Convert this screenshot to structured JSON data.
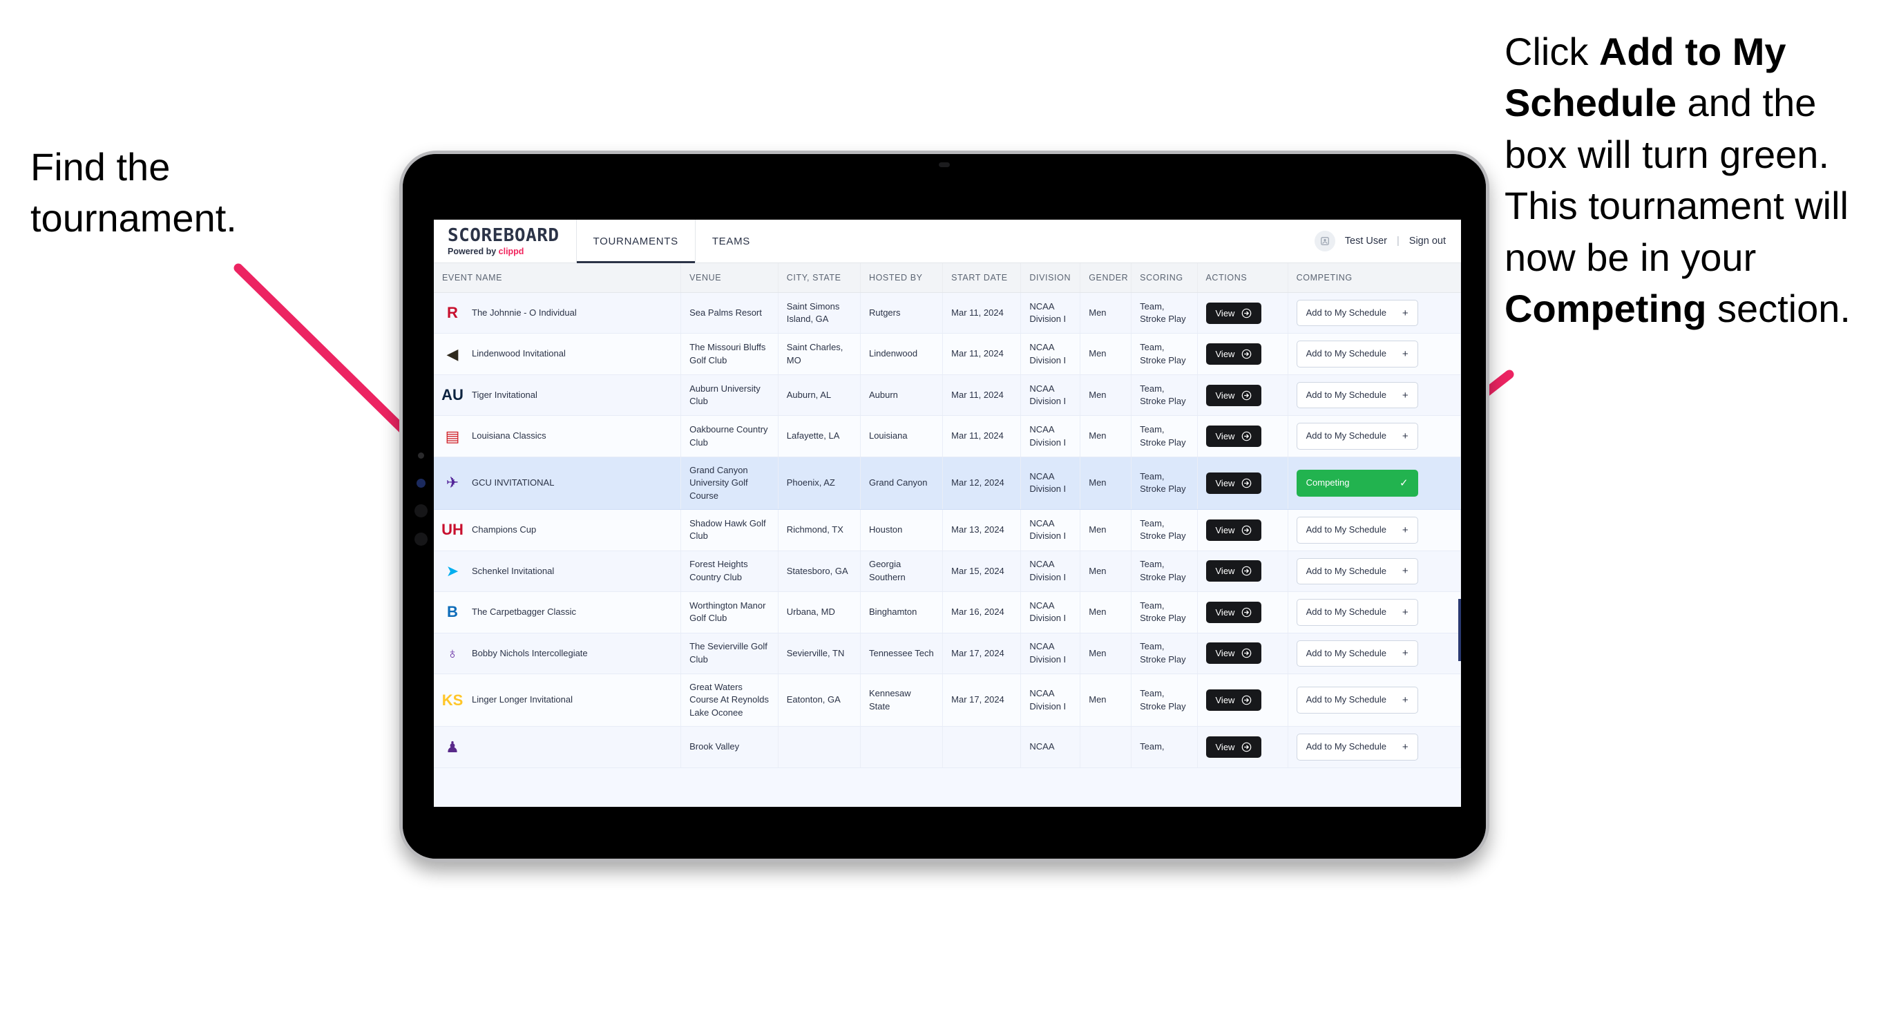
{
  "annotations": {
    "left": {
      "text": "Find the tournament."
    },
    "right": {
      "segments": [
        {
          "t": "Click ",
          "b": false
        },
        {
          "t": "Add to My Schedule",
          "b": true
        },
        {
          "t": " and the box will turn green. This tournament will now be in your ",
          "b": false
        },
        {
          "t": "Competing",
          "b": true
        },
        {
          "t": " section.",
          "b": false
        }
      ]
    },
    "arrow_color": "#ec2462"
  },
  "app": {
    "brand": {
      "name": "SCOREBOARD",
      "powered_prefix": "Powered by ",
      "powered_name": "clippd"
    },
    "tabs": [
      {
        "label": "TOURNAMENTS",
        "active": true
      },
      {
        "label": "TEAMS",
        "active": false
      }
    ],
    "account": {
      "user": "Test User",
      "separator": "|",
      "signout": "Sign out"
    },
    "table": {
      "columns": [
        "EVENT NAME",
        "VENUE",
        "CITY, STATE",
        "HOSTED BY",
        "START DATE",
        "DIVISION",
        "GENDER",
        "SCORING",
        "ACTIONS",
        "COMPETING"
      ],
      "view_label": "View",
      "add_label": "Add to My Schedule",
      "competing_label": "Competing",
      "rows": [
        {
          "logo": "R",
          "logo_color": "#c8102e",
          "logo_font": "serif",
          "event": "The Johnnie - O Individual",
          "venue": "Sea Palms Resort",
          "city": "Saint Simons Island, GA",
          "host": "Rutgers",
          "date": "Mar 11, 2024",
          "division": "NCAA Division I",
          "gender": "Men",
          "scoring": "Team, Stroke Play",
          "competing": false,
          "highlight": false
        },
        {
          "logo": "◀",
          "logo_color": "#2f2a1d",
          "logo_font": "sans",
          "event": "Lindenwood Invitational",
          "venue": "The Missouri Bluffs Golf Club",
          "city": "Saint Charles, MO",
          "host": "Lindenwood",
          "date": "Mar 11, 2024",
          "division": "NCAA Division I",
          "gender": "Men",
          "scoring": "Team, Stroke Play",
          "competing": false,
          "highlight": false
        },
        {
          "logo": "AU",
          "logo_color": "#0c2340",
          "logo_font": "serif",
          "event": "Tiger Invitational",
          "venue": "Auburn University Club",
          "city": "Auburn, AL",
          "host": "Auburn",
          "date": "Mar 11, 2024",
          "division": "NCAA Division I",
          "gender": "Men",
          "scoring": "Team, Stroke Play",
          "competing": false,
          "highlight": false
        },
        {
          "logo": "▤",
          "logo_color": "#ce181e",
          "logo_font": "sans",
          "event": "Louisiana Classics",
          "venue": "Oakbourne Country Club",
          "city": "Lafayette, LA",
          "host": "Louisiana",
          "date": "Mar 11, 2024",
          "division": "NCAA Division I",
          "gender": "Men",
          "scoring": "Team, Stroke Play",
          "competing": false,
          "highlight": false
        },
        {
          "logo": "✈",
          "logo_color": "#522398",
          "logo_font": "sans",
          "event": "GCU INVITATIONAL",
          "venue": "Grand Canyon University Golf Course",
          "city": "Phoenix, AZ",
          "host": "Grand Canyon",
          "date": "Mar 12, 2024",
          "division": "NCAA Division I",
          "gender": "Men",
          "scoring": "Team, Stroke Play",
          "competing": true,
          "highlight": true
        },
        {
          "logo": "UH",
          "logo_color": "#c8102e",
          "logo_font": "serif",
          "event": "Champions Cup",
          "venue": "Shadow Hawk Golf Club",
          "city": "Richmond, TX",
          "host": "Houston",
          "date": "Mar 13, 2024",
          "division": "NCAA Division I",
          "gender": "Men",
          "scoring": "Team, Stroke Play",
          "competing": false,
          "highlight": false
        },
        {
          "logo": "➤",
          "logo_color": "#00aeef",
          "logo_font": "sans",
          "event": "Schenkel Invitational",
          "venue": "Forest Heights Country Club",
          "city": "Statesboro, GA",
          "host": "Georgia Southern",
          "date": "Mar 15, 2024",
          "division": "NCAA Division I",
          "gender": "Men",
          "scoring": "Team, Stroke Play",
          "competing": false,
          "highlight": false
        },
        {
          "logo": "B",
          "logo_color": "#0d6cb9",
          "logo_font": "serif",
          "event": "The Carpetbagger Classic",
          "venue": "Worthington Manor Golf Club",
          "city": "Urbana, MD",
          "host": "Binghamton",
          "date": "Mar 16, 2024",
          "division": "NCAA Division I",
          "gender": "Men",
          "scoring": "Team, Stroke Play",
          "competing": false,
          "highlight": false
        },
        {
          "logo": "♁",
          "logo_color": "#5f259f",
          "logo_font": "sans",
          "event": "Bobby Nichols Intercollegiate",
          "venue": "The Sevierville Golf Club",
          "city": "Sevierville, TN",
          "host": "Tennessee Tech",
          "date": "Mar 17, 2024",
          "division": "NCAA Division I",
          "gender": "Men",
          "scoring": "Team, Stroke Play",
          "competing": false,
          "highlight": false
        },
        {
          "logo": "KS",
          "logo_color": "#ffc629",
          "logo_font": "serif",
          "event": "Linger Longer Invitational",
          "venue": "Great Waters Course At Reynolds Lake Oconee",
          "city": "Eatonton, GA",
          "host": "Kennesaw State",
          "date": "Mar 17, 2024",
          "division": "NCAA Division I",
          "gender": "Men",
          "scoring": "Team, Stroke Play",
          "competing": false,
          "highlight": false
        },
        {
          "logo": "♟",
          "logo_color": "#592a8a",
          "logo_font": "sans",
          "event": "",
          "venue": "Brook Valley",
          "city": "",
          "host": "",
          "date": "",
          "division": "NCAA",
          "gender": "",
          "scoring": "Team,",
          "competing": false,
          "highlight": false,
          "partial": true
        }
      ]
    }
  }
}
